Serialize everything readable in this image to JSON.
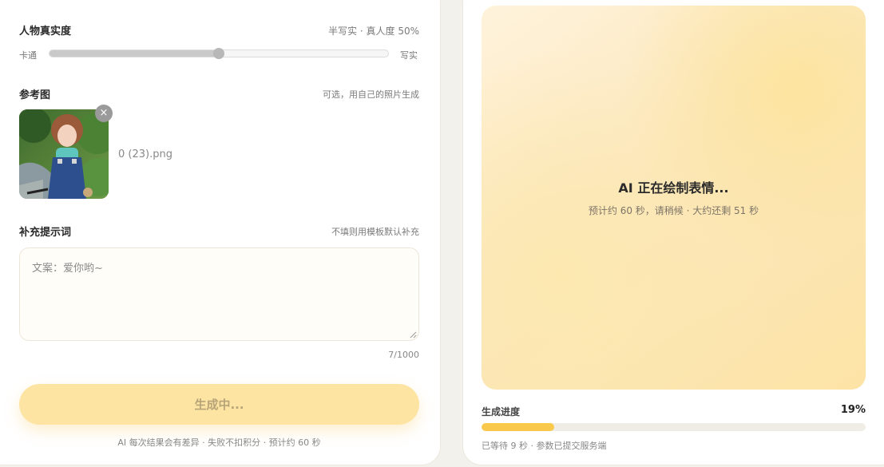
{
  "realism": {
    "title": "人物真实度",
    "summary": "半写实 · 真人度 50%",
    "left_label": "卡通",
    "right_label": "写实",
    "value": 0.5
  },
  "reference": {
    "title": "参考图",
    "hint": "可选，用自己的照片生成",
    "filename": "0 (23).png",
    "remove_icon": "×"
  },
  "prompt": {
    "title": "补充提示词",
    "hint": "不填则用模板默认补充",
    "value": "文案：爱你哟~",
    "counter": "7/1000"
  },
  "generate": {
    "label": "生成中...",
    "footnote": "AI 每次结果会有差异 · 失败不扣积分 · 预计约 60 秒"
  },
  "status": {
    "title": "AI 正在绘制表情...",
    "subtitle": "预计约 60 秒，请稍候 · 大约还剩 51 秒"
  },
  "progress": {
    "label": "生成进度",
    "percent_text": "19%",
    "value": 0.19,
    "footnote": "已等待 9 秒 · 参数已提交服务端"
  },
  "colors": {
    "accent": "#f9c94c",
    "button_bg": "#fde4a2",
    "button_text": "#b7a478"
  }
}
